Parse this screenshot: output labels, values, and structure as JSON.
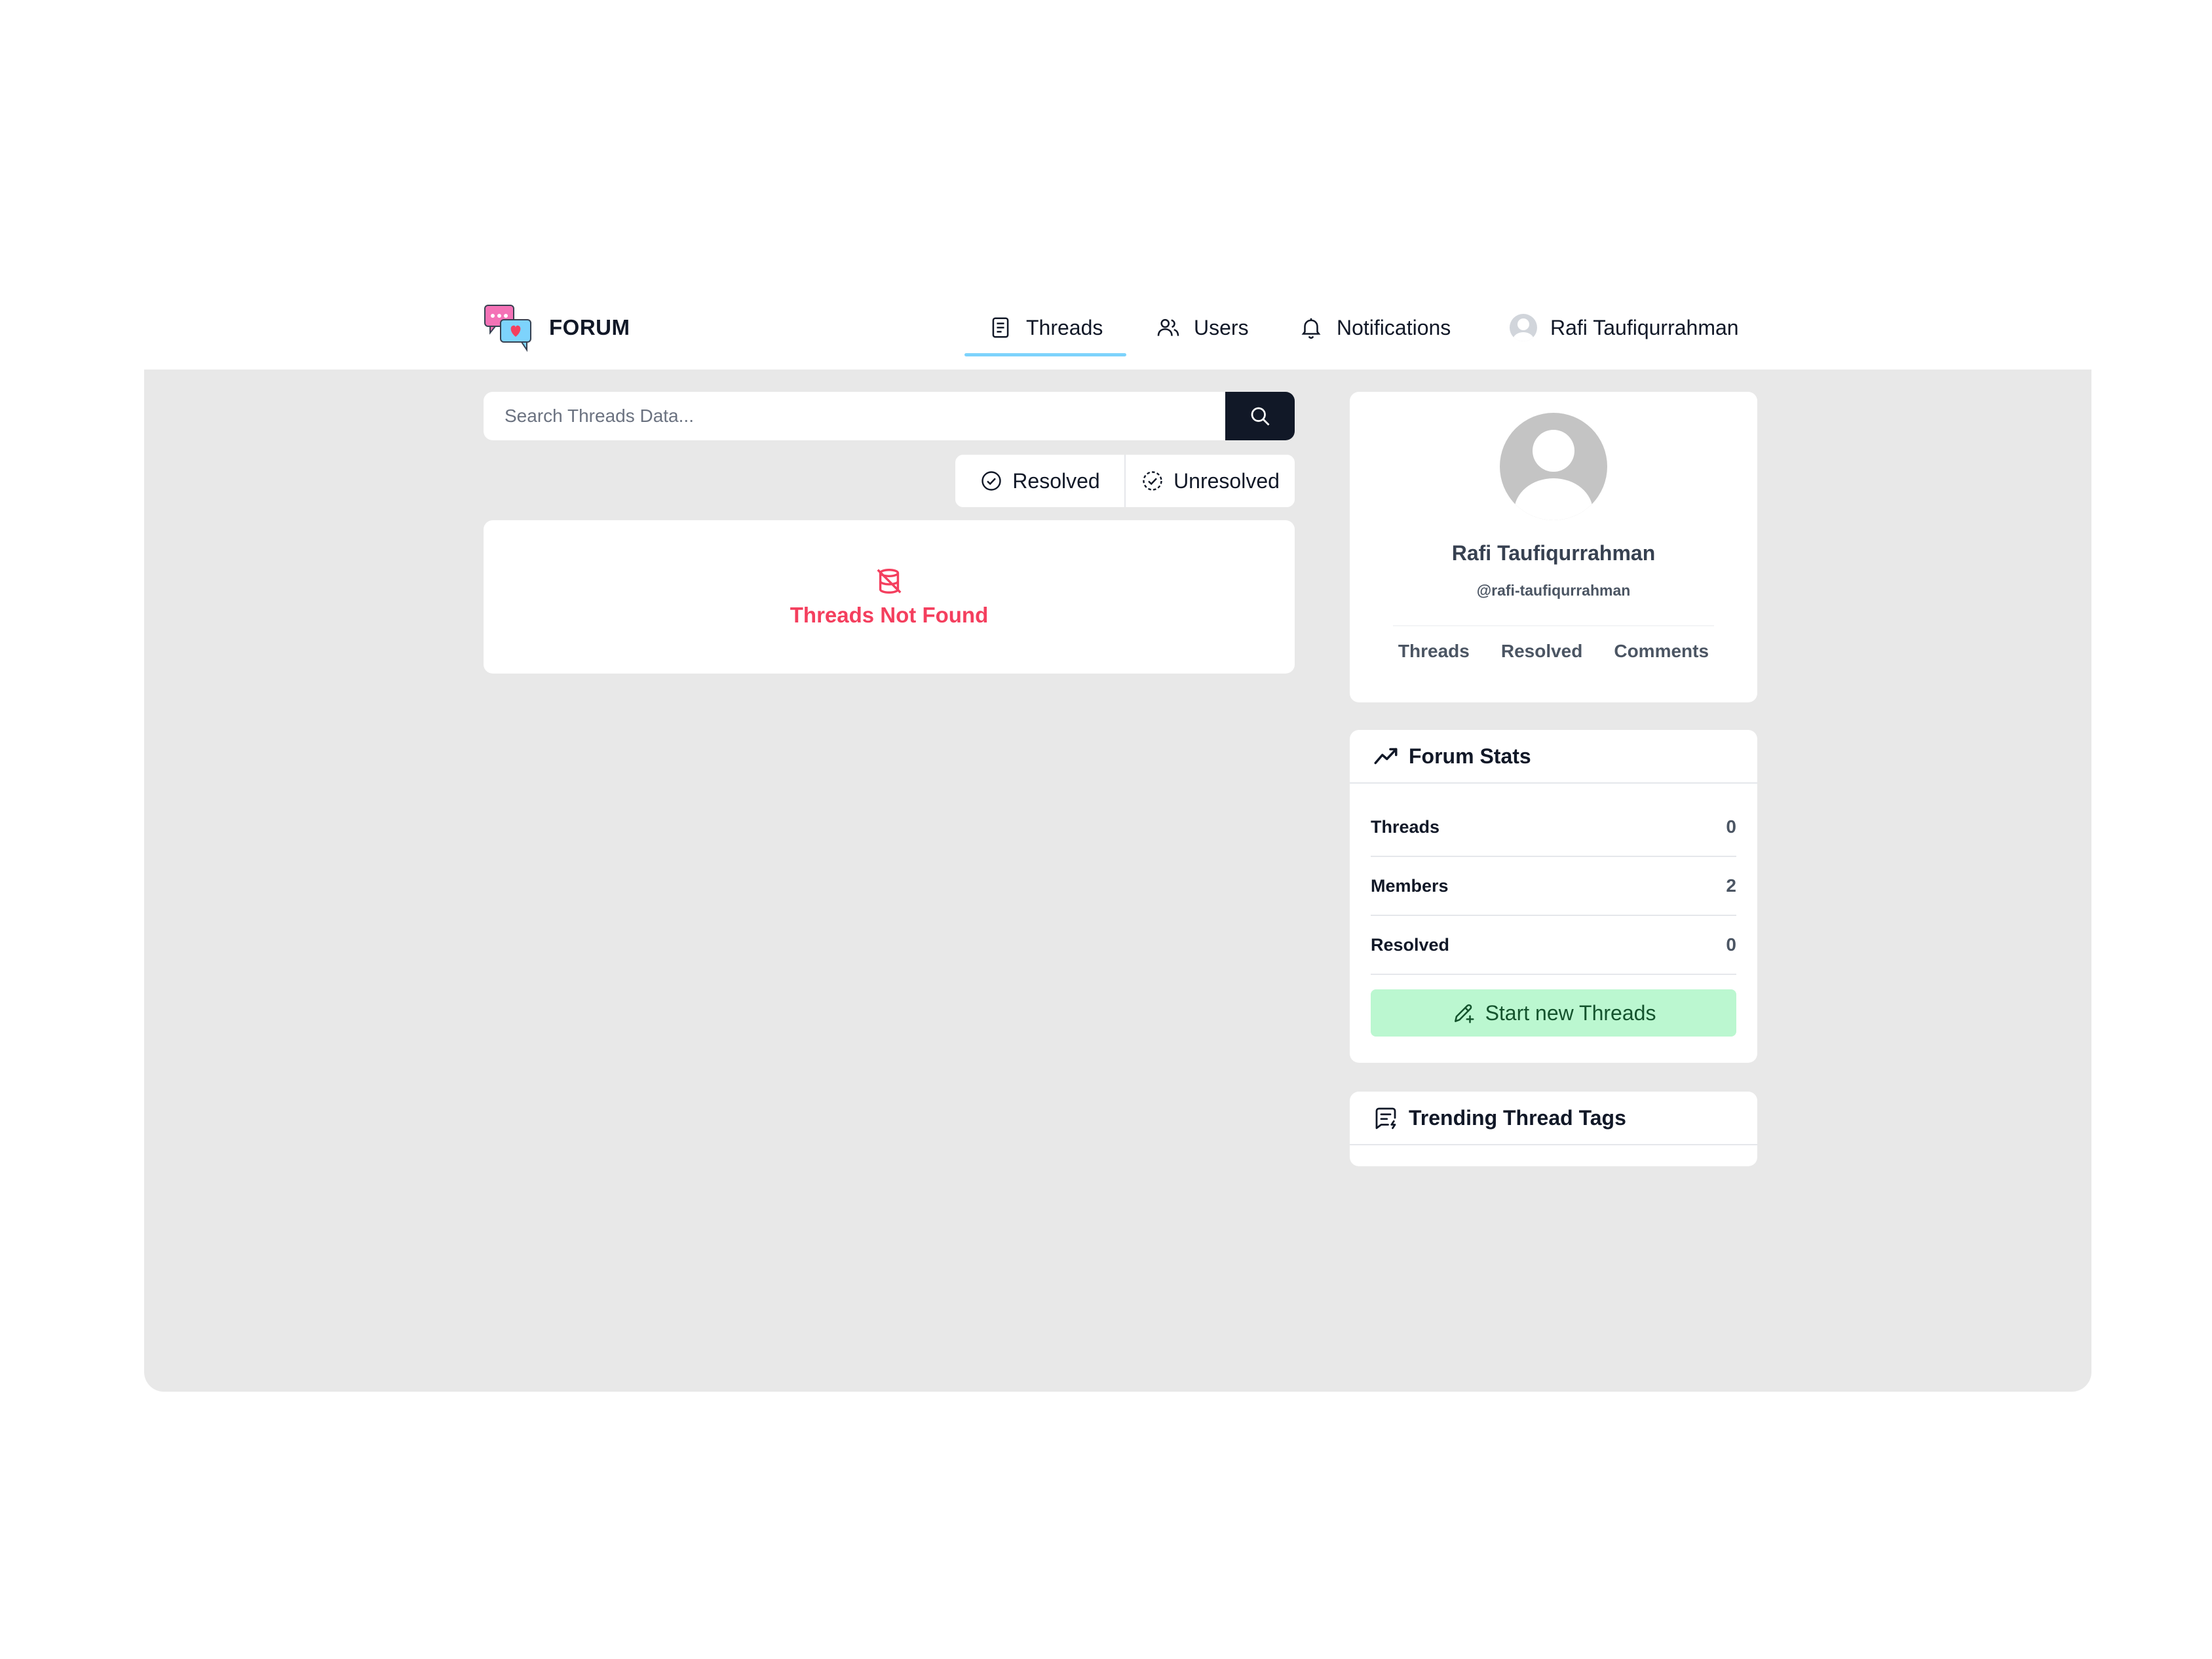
{
  "nav": {
    "brand": "FORUM",
    "logo_icon": "chat-heart-logo-icon",
    "items": [
      {
        "label": "Threads",
        "icon": "document-icon",
        "active": true
      },
      {
        "label": "Users",
        "icon": "users-icon",
        "active": false
      },
      {
        "label": "Notifications",
        "icon": "bell-icon",
        "active": false
      },
      {
        "label": "Rafi Taufiqurrahman",
        "icon": "avatar",
        "active": false
      }
    ],
    "active_underline_color": "#7dd3fc"
  },
  "search": {
    "placeholder": "Search Threads Data...",
    "button_icon": "search-icon"
  },
  "filters": {
    "resolved_label": "Resolved",
    "unresolved_label": "Unresolved"
  },
  "threads": {
    "empty_message": "Threads Not Found",
    "empty_color": "#f43f5e"
  },
  "profile": {
    "name": "Rafi Taufiqurrahman",
    "handle": "@rafi-taufiqurrahman",
    "tabs": [
      "Threads",
      "Resolved",
      "Comments"
    ]
  },
  "forum_stats": {
    "title": "Forum Stats",
    "rows": [
      {
        "label": "Threads",
        "value": "0"
      },
      {
        "label": "Members",
        "value": "2"
      },
      {
        "label": "Resolved",
        "value": "0"
      }
    ],
    "start_button": "Start new Threads",
    "start_button_color": "#bbf7d0"
  },
  "trending": {
    "title": "Trending Thread Tags"
  }
}
